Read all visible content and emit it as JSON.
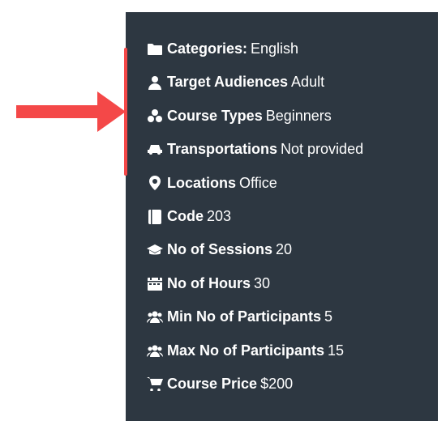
{
  "categories": {
    "label": "Categories:",
    "value": "English"
  },
  "targetAudiences": {
    "label": "Target Audiences",
    "value": "Adult"
  },
  "courseTypes": {
    "label": "Course Types",
    "value": "Beginners"
  },
  "transportations": {
    "label": "Transportations",
    "value": "Not provided"
  },
  "locations": {
    "label": "Locations",
    "value": "Office"
  },
  "code": {
    "label": "Code",
    "value": "203"
  },
  "sessions": {
    "label": "No of Sessions",
    "value": "20"
  },
  "hours": {
    "label": "No of Hours",
    "value": "30"
  },
  "minParticipants": {
    "label": "Min No of Participants",
    "value": "5"
  },
  "maxParticipants": {
    "label": "Max No of Participants",
    "value": "15"
  },
  "price": {
    "label": "Course Price",
    "value": "$200"
  }
}
